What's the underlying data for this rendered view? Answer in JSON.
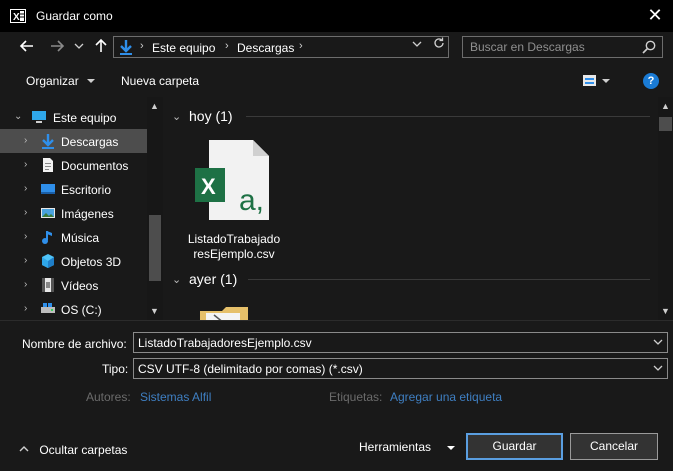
{
  "window": {
    "title": "Guardar como",
    "app_icon": "excel-icon",
    "close_glyph": "✕"
  },
  "nav": {
    "back_icon": "arrow-left-icon",
    "forward_icon": "arrow-right-icon",
    "recent_icon": "chevron-down-icon",
    "up_icon": "arrow-up-icon",
    "address": {
      "location_icon": "download-arrow-icon",
      "segments": [
        "Este equipo",
        "Descargas"
      ],
      "separator": "›"
    },
    "refresh_icon": "refresh-icon",
    "search": {
      "placeholder": "Buscar en Descargas",
      "value": ""
    }
  },
  "toolbar": {
    "organize_label": "Organizar",
    "new_folder_label": "Nueva carpeta",
    "view_icon": "view-options-icon",
    "help_label": "?"
  },
  "sidebar": {
    "items": [
      {
        "label": "Este equipo",
        "icon": "computer-icon",
        "expanded": true
      },
      {
        "label": "Descargas",
        "icon": "download-arrow-icon",
        "selected": true
      },
      {
        "label": "Documentos",
        "icon": "document-icon"
      },
      {
        "label": "Escritorio",
        "icon": "desktop-icon"
      },
      {
        "label": "Imágenes",
        "icon": "pictures-icon"
      },
      {
        "label": "Música",
        "icon": "music-icon"
      },
      {
        "label": "Objetos 3D",
        "icon": "cube-3d-icon"
      },
      {
        "label": "Vídeos",
        "icon": "video-icon"
      },
      {
        "label": "OS (C:)",
        "icon": "drive-icon"
      }
    ]
  },
  "content": {
    "groups": [
      {
        "label": "hoy (1)"
      },
      {
        "label": "ayer (1)"
      }
    ],
    "file": {
      "name_line1": "ListadoTrabajado",
      "name_line2": "resEjemplo.csv",
      "icon": "excel-csv-file-icon"
    },
    "folder_icon": "folder-icon"
  },
  "form": {
    "filename_label": "Nombre de archivo:",
    "filename_value": "ListadoTrabajadoresEjemplo.csv",
    "type_label": "Tipo:",
    "type_value": "CSV UTF-8 (delimitado por comas) (*.csv)",
    "authors_label": "Autores:",
    "authors_value": "Sistemas Alfil",
    "tags_label": "Etiquetas:",
    "tags_value": "Agregar una etiqueta"
  },
  "footer": {
    "hide_folders_label": "Ocultar carpetas",
    "tools_label": "Herramientas",
    "save_label": "Guardar",
    "cancel_label": "Cancelar"
  },
  "colors": {
    "background": "#191919",
    "titlebar": "#000000",
    "selection": "#4d4d4d",
    "excel_green": "#217346",
    "accent_blue": "#1a7bd5",
    "link": "#3f7fc2",
    "muted_text": "#6b6b6b"
  }
}
